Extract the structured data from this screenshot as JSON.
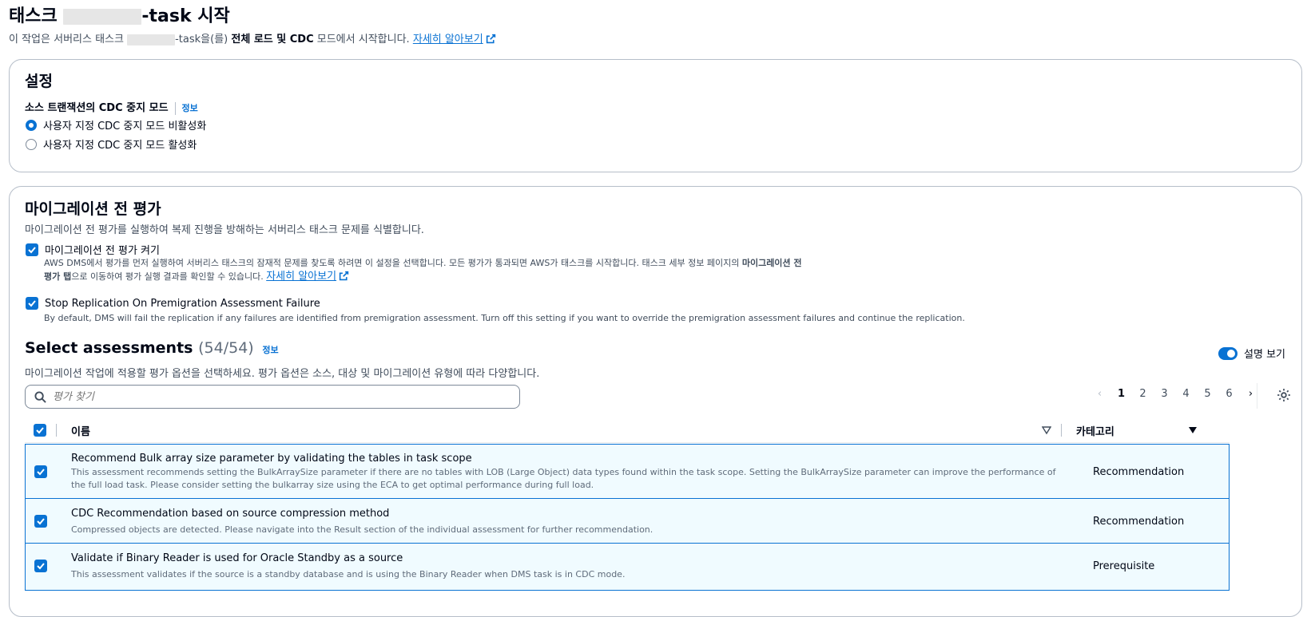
{
  "header": {
    "title_prefix": "태스크",
    "title_suffix": "-task 시작",
    "subtitle_pre": "이 작업은 서버리스 태스크",
    "subtitle_mid": "-task을(를)",
    "subtitle_bold": "전체 로드 및 CDC",
    "subtitle_post": "모드에서 시작합니다.",
    "learn_more": "자세히 알아보기"
  },
  "settings": {
    "heading": "설정",
    "field_label": "소스 트랜잭션의 CDC 중지 모드",
    "info": "정보",
    "options": [
      {
        "label": "사용자 지정 CDC 중지 모드 비활성화",
        "selected": true
      },
      {
        "label": "사용자 지정 CDC 중지 모드 활성화",
        "selected": false
      }
    ]
  },
  "premigration": {
    "heading": "마이그레이션 전 평가",
    "description": "마이그레이션 전 평가를 실행하여 복제 진행을 방해하는 서버리스 태스크 문제를 식별합니다.",
    "enable": {
      "label": "마이그레이션 전 평가 켜기",
      "line1": "AWS DMS에서 평가를 먼저 실행하여 서버리스 태스크의 잠재적 문제를 찾도록 하려면 이 설정을 선택합니다. 모든 평가가 통과되면 AWS가 태스크를 시작합니다. 태스크 세부 정보 페이지의",
      "line1_bold": "마이그레이션 전",
      "line2_bold": "평가 탭",
      "line2": "으로 이동하여 평가 실행 결과를 확인할 수 있습니다.",
      "learn_more": "자세히 알아보기"
    },
    "stop": {
      "label": "Stop Replication On Premigration Assessment Failure",
      "description": "By default, DMS will fail the replication if any failures are identified from premigration assessment. Turn off this setting if you want to override the premigration assessment failures and continue the replication."
    }
  },
  "assessments": {
    "heading": "Select assessments",
    "count": "(54/54)",
    "info": "정보",
    "description": "마이그레이션 작업에 적용할 평가 옵션을 선택하세요. 평가 옵션은 소스, 대상 및 마이그레이션 유형에 따라 다양합니다.",
    "toggle_label": "설명 보기",
    "search_placeholder": "평가 찾기",
    "pages": [
      "1",
      "2",
      "3",
      "4",
      "5",
      "6"
    ],
    "current_page": "1",
    "columns": {
      "name": "이름",
      "category": "카테고리"
    },
    "rows": [
      {
        "name": "Recommend Bulk array size parameter by validating the tables in task scope",
        "description": "This assessment recommends setting the BulkArraySize parameter if there are no tables with LOB (Large Object) data types found within the task scope. Setting the BulkArraySize parameter can improve the performance of the full load task. Please consider setting the bulkarray size using the ECA to get optimal performance during full load.",
        "category": "Recommendation"
      },
      {
        "name": "CDC Recommendation based on source compression method",
        "description": "Compressed objects are detected. Please navigate into the Result section of the individual assessment for further recommendation.",
        "category": "Recommendation"
      },
      {
        "name": "Validate if Binary Reader is used for Oracle Standby as a source",
        "description": "This assessment validates if the source is a standby database and is using the Binary Reader when DMS task is in CDC mode.",
        "category": "Prerequisite"
      }
    ]
  }
}
